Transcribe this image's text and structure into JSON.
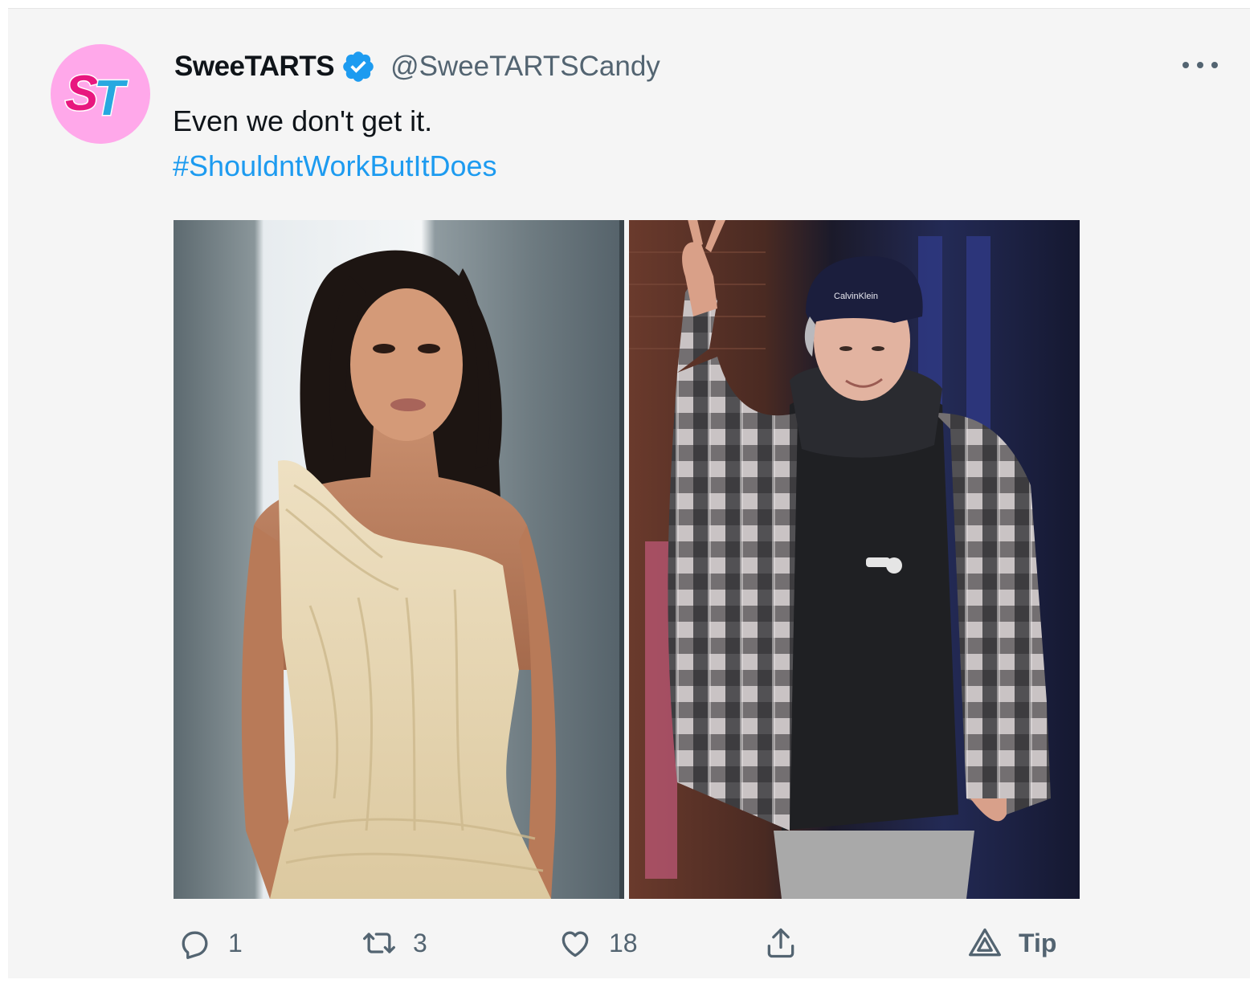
{
  "tweet": {
    "display_name": "SweeTARTS",
    "handle": "@SweeTARTSCandy",
    "avatar_text": "ST",
    "text": "Even we don't get it.",
    "hashtag": "#ShouldntWorkButItDoes",
    "media": [
      {
        "label": "photo-left"
      },
      {
        "label": "photo-right"
      }
    ],
    "actions": {
      "reply_count": "1",
      "retweet_count": "3",
      "like_count": "18",
      "tip_label": "Tip"
    }
  },
  "colors": {
    "brand_pink": "#ffa8ea",
    "verified_blue": "#1d9bf0",
    "link_blue": "#1d9bf0",
    "text_gray": "#536471"
  },
  "icons": [
    "verified-badge-icon",
    "more-icon",
    "reply-icon",
    "retweet-icon",
    "like-icon",
    "share-icon",
    "tip-icon"
  ]
}
